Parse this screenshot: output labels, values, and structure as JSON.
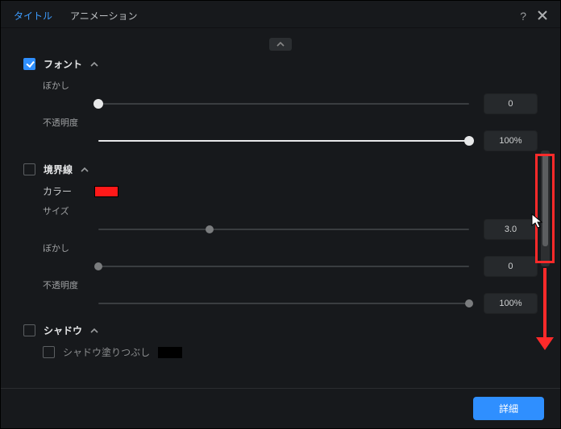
{
  "tabs": {
    "title": "タイトル",
    "animation": "アニメーション"
  },
  "sections": {
    "font": {
      "label": "フォント",
      "blur": {
        "label": "ぼかし",
        "value": "0"
      },
      "opacity": {
        "label": "不透明度",
        "value": "100%"
      }
    },
    "border": {
      "label": "境界線",
      "color_label": "カラー",
      "size": {
        "label": "サイズ",
        "value": "3.0"
      },
      "blur": {
        "label": "ぼかし",
        "value": "0"
      },
      "opacity": {
        "label": "不透明度",
        "value": "100%"
      }
    },
    "shadow": {
      "label": "シャドウ",
      "fill_label": "シャドウ塗りつぶし"
    }
  },
  "footer": {
    "advanced": "詳細"
  },
  "icons": {
    "help": "?",
    "close": "×"
  },
  "colors": {
    "border_swatch": "#ff1919",
    "shadow_swatch": "#000000",
    "accent": "#2f8fff"
  }
}
